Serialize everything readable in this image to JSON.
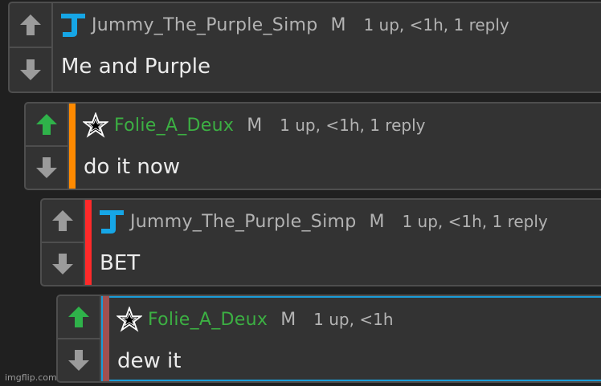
{
  "colors": {
    "background": "#202020",
    "panel": "#333333",
    "upvote_active": "#2fb24a",
    "vote_inactive": "#9b9b9b",
    "depth_orange": "#ff8a00",
    "depth_red": "#ff2a2a",
    "depth_brown": "#a05050",
    "highlight_blue": "#1a9cd8",
    "username_green": "#3cb043"
  },
  "comments": [
    {
      "username": "Jummy_The_Purple_Simp",
      "icon": "j-letter-icon",
      "mod_mark": "M",
      "meta": "1 up, <1h, 1 reply",
      "text": "Me and Purple",
      "upvoted": false
    },
    {
      "username": "Folie_A_Deux",
      "icon": "star-icon",
      "mod_mark": "M",
      "meta": "1 up, <1h, 1 reply",
      "text": "do it now",
      "upvoted": true
    },
    {
      "username": "Jummy_The_Purple_Simp",
      "icon": "j-letter-icon",
      "mod_mark": "M",
      "meta": "1 up, <1h, 1 reply",
      "text": "BET",
      "upvoted": false
    },
    {
      "username": "Folie_A_Deux",
      "icon": "star-icon",
      "mod_mark": "M",
      "meta": "1 up, <1h",
      "text": "dew it",
      "upvoted": true
    }
  ],
  "watermark": "imgflip.com"
}
